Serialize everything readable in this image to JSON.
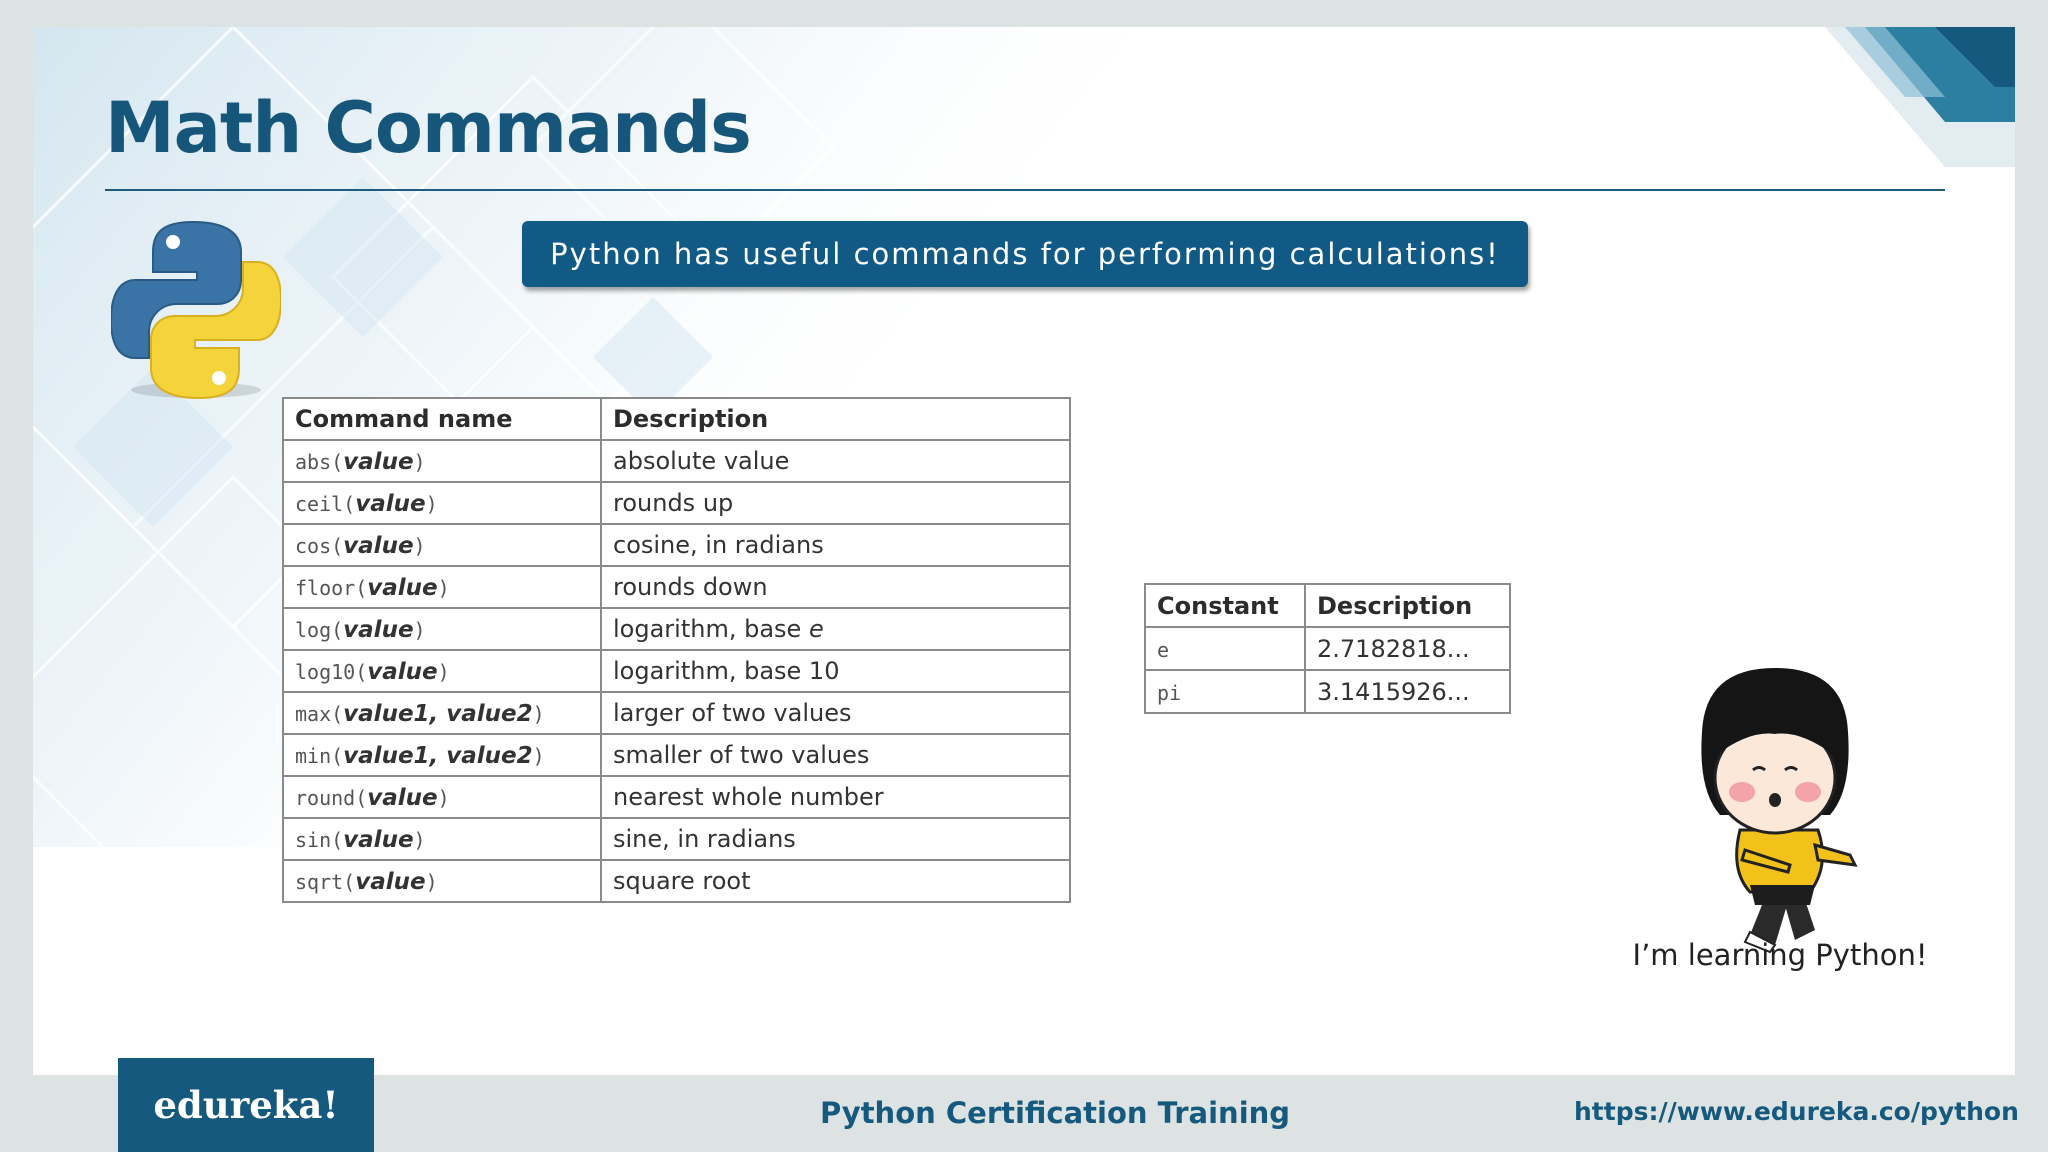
{
  "title": "Math Commands",
  "banner": "Python has useful commands for performing calculations!",
  "commands_table": {
    "headers": [
      "Command name",
      "Description"
    ],
    "rows": [
      {
        "fn": "abs",
        "args": "value",
        "desc": "absolute value"
      },
      {
        "fn": "ceil",
        "args": "value",
        "desc": "rounds up"
      },
      {
        "fn": "cos",
        "args": "value",
        "desc": "cosine, in radians"
      },
      {
        "fn": "floor",
        "args": "value",
        "desc": "rounds down"
      },
      {
        "fn": "log",
        "args": "value",
        "desc_pre": "logarithm, base ",
        "desc_it": "e"
      },
      {
        "fn": "log10",
        "args": "value",
        "desc": "logarithm, base 10"
      },
      {
        "fn": "max",
        "args": "value1, value2",
        "desc": "larger of two values"
      },
      {
        "fn": "min",
        "args": "value1, value2",
        "desc": "smaller of two values"
      },
      {
        "fn": "round",
        "args": "value",
        "desc": "nearest whole number"
      },
      {
        "fn": "sin",
        "args": "value",
        "desc": "sine, in radians"
      },
      {
        "fn": "sqrt",
        "args": "value",
        "desc": "square root"
      }
    ]
  },
  "constants_table": {
    "headers": [
      "Constant",
      "Description"
    ],
    "rows": [
      {
        "name": "e",
        "value": "2.7182818..."
      },
      {
        "name": "pi",
        "value": "3.1415926..."
      }
    ]
  },
  "caption": "I’m learning Python!",
  "footer": {
    "logo": "edureka!",
    "course": "Python Certification Training",
    "url": "https://www.edureka.co/python"
  },
  "colors": {
    "brand": "#155a7e",
    "banner": "#115a86",
    "python_blue": "#3a74a6",
    "python_yellow": "#f5d33b"
  },
  "icons": [
    "python-logo-icon",
    "cartoon-girl-illustration"
  ]
}
